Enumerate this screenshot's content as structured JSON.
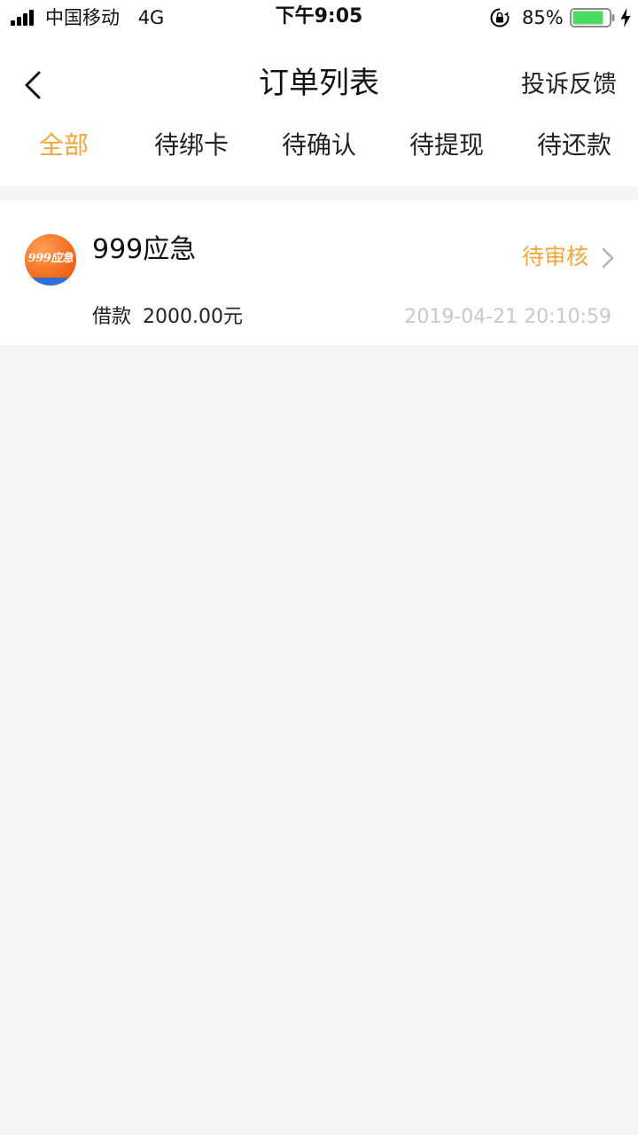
{
  "status_bar": {
    "carrier": "中国移动",
    "network": "4G",
    "time": "下午9:05",
    "battery_percent": "85%",
    "battery_level": 0.85,
    "icons": [
      "signal-icon",
      "rotation-lock-icon",
      "battery-icon",
      "charging-bolt-icon"
    ]
  },
  "header": {
    "title": "订单列表",
    "back_icon": "chevron-left-icon",
    "feedback_label": "投诉反馈"
  },
  "tabs": [
    {
      "label": "全部",
      "active": true
    },
    {
      "label": "待绑卡",
      "active": false
    },
    {
      "label": "待确认",
      "active": false
    },
    {
      "label": "待提现",
      "active": false
    },
    {
      "label": "待还款",
      "active": false
    }
  ],
  "orders": [
    {
      "app_name": "999应急",
      "logo_text": "999应急",
      "status": "待审核",
      "loan_label": "借款",
      "amount": "2000.00元",
      "datetime": "2019-04-21 20:10:59"
    }
  ],
  "colors": {
    "accent": "#f5a53a",
    "background": "#f4f4f4",
    "timestamp": "#c8c8c8"
  }
}
